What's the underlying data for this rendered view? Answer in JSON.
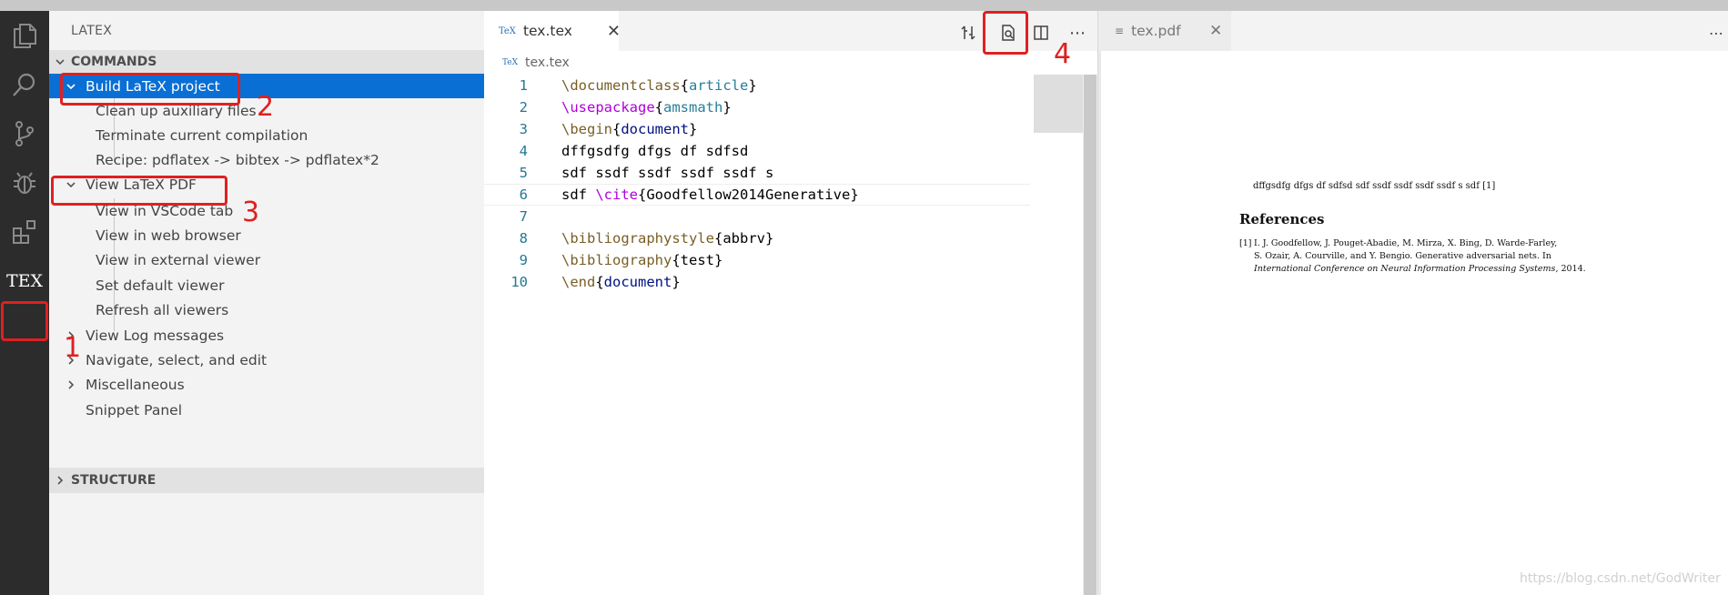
{
  "sidebar": {
    "title": "LATEX",
    "commands_header": "COMMANDS",
    "structure_header": "STRUCTURE",
    "items": [
      {
        "label": "Build LaTeX project"
      },
      {
        "label": "Clean up auxiliary files"
      },
      {
        "label": "Terminate current compilation"
      },
      {
        "label": "Recipe: pdflatex -> bibtex -> pdflatex*2"
      },
      {
        "label": "View LaTeX PDF"
      },
      {
        "label": "View in VSCode tab"
      },
      {
        "label": "View in web browser"
      },
      {
        "label": "View in external viewer"
      },
      {
        "label": "Set default viewer"
      },
      {
        "label": "Refresh all viewers"
      },
      {
        "label": "View Log messages"
      },
      {
        "label": "Navigate, select, and edit"
      },
      {
        "label": "Miscellaneous"
      },
      {
        "label": "Snippet Panel"
      }
    ]
  },
  "activity": {
    "icons": [
      "explorer-icon",
      "search-icon",
      "source-control-icon",
      "debug-icon",
      "extensions-icon",
      "tex-icon"
    ],
    "tex_label": "TEX"
  },
  "editor": {
    "tab_icon": "TeX",
    "tab_label": "tex.tex",
    "breadcrumb_icon": "TeX",
    "breadcrumb": "tex.tex",
    "line_numbers": [
      "1",
      "2",
      "3",
      "4",
      "5",
      "6",
      "7",
      "8",
      "9",
      "10"
    ],
    "lines": {
      "l1_cmd": "\\documentclass",
      "l1_arg": "article",
      "l2_cmd": "\\usepackage",
      "l2_arg": "amsmath",
      "l3_cmd": "\\begin",
      "l3_arg": "document",
      "l4": "dffgsdfg dfgs df sdfsd",
      "l5": "sdf ssdf ssdf ssdf ssdf s",
      "l6_pre": "sdf ",
      "l6_cmd": "\\cite",
      "l6_arg": "Goodfellow2014Generative",
      "l8_cmd": "\\bibliographystyle",
      "l8_arg": "abbrv",
      "l9_cmd": "\\bibliography",
      "l9_arg": "test",
      "l10_cmd": "\\end",
      "l10_arg": "document"
    }
  },
  "pdf": {
    "tab_label": "tex.pdf",
    "body_line": "dffgsdfg dfgs df sdfsd sdf ssdf ssdf ssdf ssdf s sdf [1]",
    "references_title": "References",
    "ref_num": "[1]",
    "ref_line1": "I. J. Goodfellow, J. Pouget-Abadie, M. Mirza, X. Bing, D. Warde-Farley,",
    "ref_line2": "S. Ozair, A. Courville, and Y. Bengio.  Generative adversarial nets.  In",
    "ref_line3_italic": "International Conference on Neural Information Processing Systems",
    "ref_line3_tail": ", 2014."
  },
  "annotations": [
    "1",
    "2",
    "3",
    "4"
  ],
  "watermark": "https://blog.csdn.net/GodWriter",
  "colors": {
    "accent": "#0a6fd4",
    "annotation": "#e02020",
    "activity_bg": "#2c2c2c"
  }
}
